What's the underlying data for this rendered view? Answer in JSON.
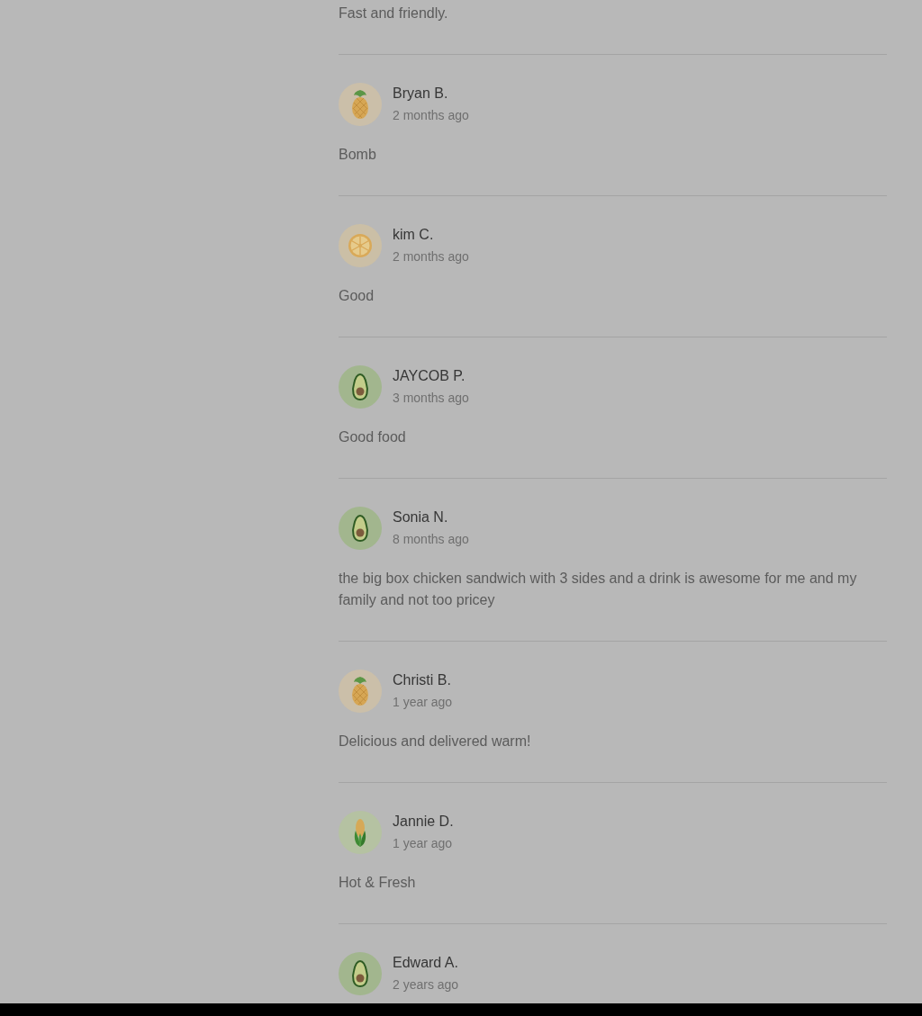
{
  "reviews": [
    {
      "text": "Fast and friendly."
    },
    {
      "name": "Bryan B.",
      "time": "2 months ago",
      "avatar": {
        "kind": "pineapple"
      },
      "text": "Bomb"
    },
    {
      "name": "kim C.",
      "time": "2 months ago",
      "avatar": {
        "kind": "citrus"
      },
      "text": "Good"
    },
    {
      "name": "JAYCOB P.",
      "time": "3 months ago",
      "avatar": {
        "kind": "avocado"
      },
      "text": "Good food"
    },
    {
      "name": "Sonia N.",
      "time": "8 months ago",
      "avatar": {
        "kind": "avocado"
      },
      "text": "the big box chicken sandwich with 3 sides and a drink is awesome for me and my family and not too pricey"
    },
    {
      "name": "Christi B.",
      "time": "1 year ago",
      "avatar": {
        "kind": "pineapple"
      },
      "text": "Delicious and delivered warm!"
    },
    {
      "name": "Jannie D.",
      "time": "1 year ago",
      "avatar": {
        "kind": "corn"
      },
      "text": "Hot & Fresh"
    },
    {
      "name": "Edward A.",
      "time": "2 years ago",
      "avatar": {
        "kind": "avocado"
      }
    }
  ]
}
